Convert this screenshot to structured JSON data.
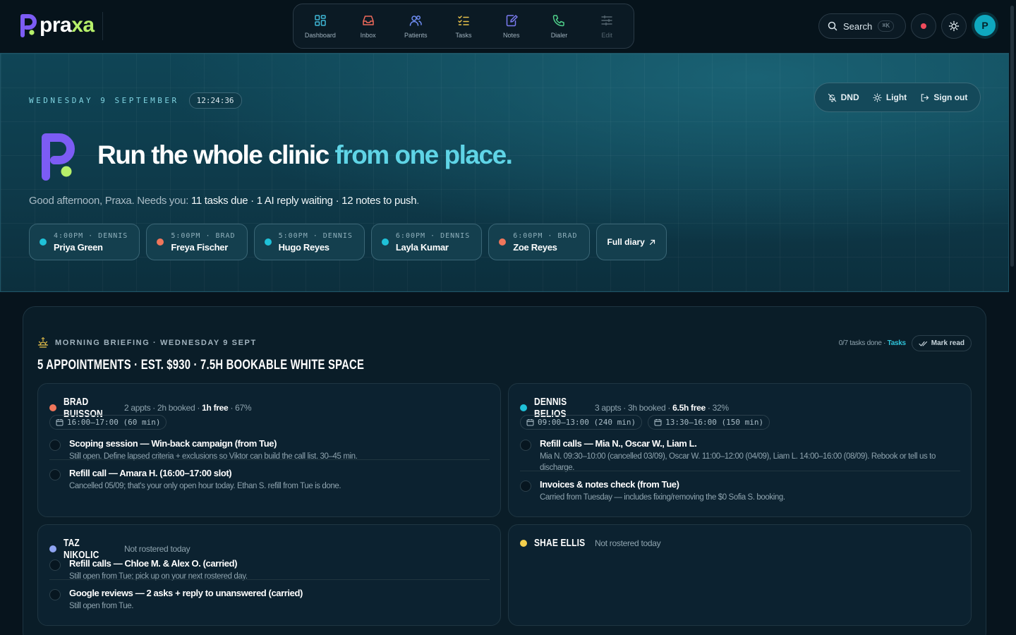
{
  "brand": {
    "name_main": "pra",
    "name_accent": "xa"
  },
  "nav": [
    {
      "label": "Dashboard",
      "icon": "dashboard-icon",
      "color": "#3fb8d6"
    },
    {
      "label": "Inbox",
      "icon": "inbox-icon",
      "color": "#ef6a5b"
    },
    {
      "label": "Patients",
      "icon": "patients-icon",
      "color": "#6e8cf2"
    },
    {
      "label": "Tasks",
      "icon": "tasks-icon",
      "color": "#e8c14a"
    },
    {
      "label": "Notes",
      "icon": "notes-icon",
      "color": "#7c7cf2"
    },
    {
      "label": "Dialer",
      "icon": "phone-icon",
      "color": "#4fd08a"
    },
    {
      "label": "Edit",
      "icon": "sliders-icon",
      "color": "#55656f"
    }
  ],
  "header": {
    "search_label": "Search",
    "search_shortcut": "⌘K",
    "avatar_initial": "P"
  },
  "hero": {
    "date": "WEDNESDAY 9 SEPTEMBER",
    "time": "12:24:36",
    "actions": {
      "dnd": "DND",
      "light": "Light",
      "signout": "Sign out"
    },
    "headline_main": "Run the whole clinic ",
    "headline_accent": "from one place.",
    "greeting": "Good afternoon, Praxa. Needs you: ",
    "needs": "11 tasks due · 1 AI reply waiting · 12 notes to push",
    "period": ".",
    "appointments": [
      {
        "meta": "4:00PM · DENNIS",
        "name": "Priya Green",
        "color": "#1fc1d8"
      },
      {
        "meta": "5:00PM · BRAD",
        "name": "Freya Fischer",
        "color": "#f0765b"
      },
      {
        "meta": "5:00PM · DENNIS",
        "name": "Hugo Reyes",
        "color": "#1fc1d8"
      },
      {
        "meta": "6:00PM · DENNIS",
        "name": "Layla Kumar",
        "color": "#1fc1d8"
      },
      {
        "meta": "6:00PM · BRAD",
        "name": "Zoe Reyes",
        "color": "#f0765b"
      }
    ],
    "diary_label": "Full diary"
  },
  "briefing": {
    "kicker": "MORNING BRIEFING · WEDNESDAY 9 SEPT",
    "title": "5 APPOINTMENTS · EST. $930 · 7.5H BOOKABLE WHITE SPACE",
    "tasks_done": "0/7 tasks done · ",
    "tasks_link": "Tasks",
    "mark_read": "Mark read",
    "staff": [
      {
        "name": "BRAD BUISSON",
        "color": "#f0765b",
        "stats_pre": "2 appts · 2h booked · ",
        "stats_bold": "1h free",
        "stats_post": " · 67%",
        "slots": [
          "16:00–17:00 (60 min)"
        ],
        "tasks": [
          {
            "title": "Scoping session — Win-back campaign (from Tue)",
            "desc": "Still open. Define lapsed criteria + exclusions so Viktor can build the call list. 30–45 min."
          },
          {
            "title": "Refill call — Amara H. (16:00–17:00 slot)",
            "desc": "Cancelled 05/09; that's your only open hour today. Ethan S. refill from Tue is done."
          }
        ]
      },
      {
        "name": "DENNIS BELIOS",
        "color": "#1fc1d8",
        "stats_pre": "3 appts · 3h booked · ",
        "stats_bold": "6.5h free",
        "stats_post": " · 32%",
        "slots": [
          "09:00–13:00 (240 min)",
          "13:30–16:00 (150 min)"
        ],
        "tasks": [
          {
            "title": "Refill calls — Mia N., Oscar W., Liam L.",
            "desc": "Mia N. 09:30–10:00 (cancelled 03/09), Oscar W. 11:00–12:00 (04/09), Liam L. 14:00–16:00 (08/09). Rebook or tell us to discharge."
          },
          {
            "title": "Invoices & notes check (from Tue)",
            "desc": "Carried from Tuesday — includes fixing/removing the $0 Sofia S. booking."
          }
        ]
      },
      {
        "name": "TAZ NIKOLIC",
        "color": "#8fa4f2",
        "stats_pre": "Not rostered today",
        "stats_bold": "",
        "stats_post": "",
        "slots": [],
        "tasks": [
          {
            "title": "Refill calls — Chloe M. & Alex O. (carried)",
            "desc": "Still open from Tue; pick up on your next rostered day."
          },
          {
            "title": "Google reviews — 2 asks + reply to unanswered (carried)",
            "desc": "Still open from Tue."
          }
        ]
      },
      {
        "name": "SHAE ELLIS",
        "color": "#f3cf4d",
        "stats_pre": "Not rostered today",
        "stats_bold": "",
        "stats_post": "",
        "slots": [],
        "tasks": []
      }
    ]
  }
}
